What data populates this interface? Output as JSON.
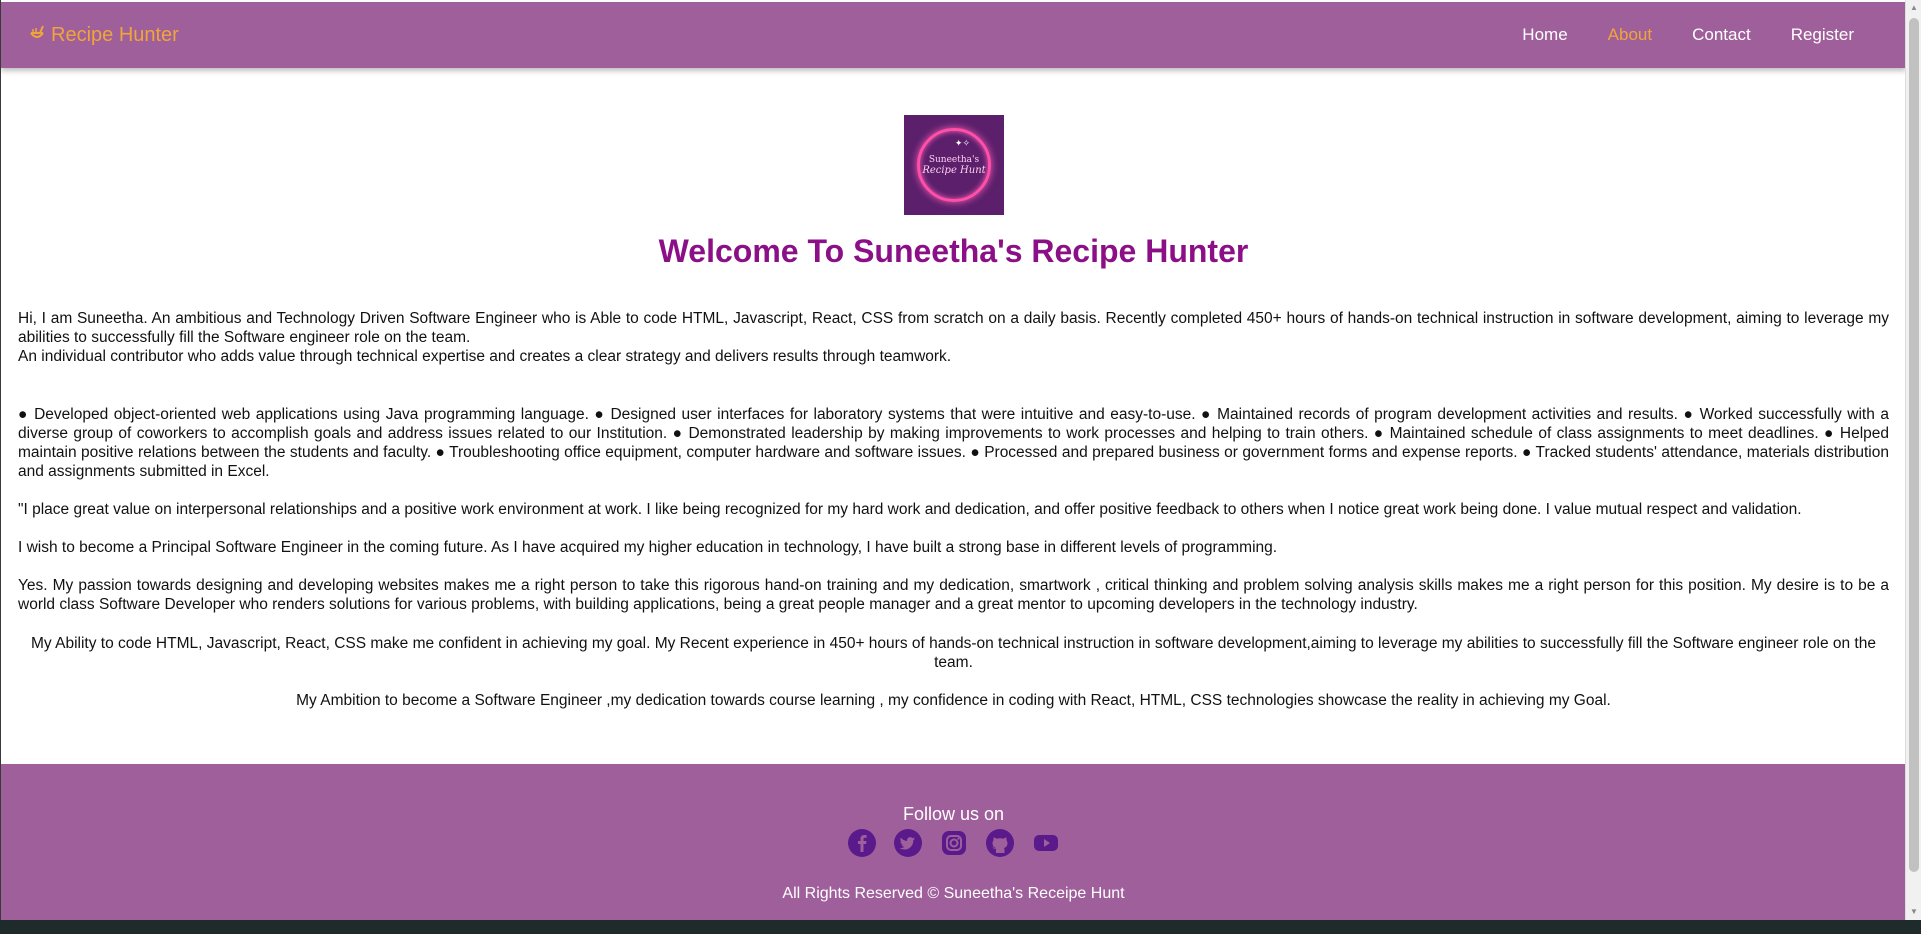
{
  "nav": {
    "brand": "Recipe Hunter",
    "links": [
      "Home",
      "About",
      "Contact",
      "Register"
    ],
    "active": "About"
  },
  "logo": {
    "line1": "Suneetha's",
    "line2": "Recipe Hunt"
  },
  "main": {
    "title": "Welcome To Suneetha's Recipe Hunter",
    "p1a": "Hi, I am Suneetha. An ambitious and Technology Driven Software Engineer who is Able to code HTML, Javascript, React, CSS from scratch on a daily basis. Recently completed 450+ hours of hands-on technical instruction in software development, aiming to leverage my abilities to successfully fill the Software engineer role on the team.",
    "p1b": "An individual contributor who adds value through technical expertise and creates a clear strategy and delivers results through teamwork.",
    "p2": "● Developed object-oriented web applications using Java programming language. ● Designed user interfaces for laboratory systems that were intuitive and easy-to-use. ● Maintained records of program development activities and results. ● Worked successfully with a diverse group of coworkers to accomplish goals and address issues related to our Institution. ● Demonstrated leadership by making improvements to work processes and helping to train others. ● Maintained schedule of class assignments to meet deadlines. ● Helped maintain positive relations between the students and faculty. ● Troubleshooting office equipment, computer hardware and software issues. ● Processed and prepared business or government forms and expense reports. ● Tracked students' attendance, materials distribution and assignments submitted in Excel.",
    "p3": "\"I place great value on interpersonal relationships and a positive work environment at work. I like being recognized for my hard work and dedication, and offer positive feedback to others when I notice great work being done. I value mutual respect and validation.",
    "p4": "I wish to become a Principal Software Engineer in the coming future. As I have acquired my higher education in technology, I have built a strong base in different levels of programming.",
    "p5": "Yes. My passion towards designing and developing websites makes me a right person to take this rigorous hand-on training and my dedication, smartwork , critical thinking and problem solving analysis skills makes me a right person for this position. My desire is to be a world class Software Developer who renders solutions for various problems, with building applications, being a great people manager and a great mentor to upcoming developers in the technology industry.",
    "p6": "My Ability to code HTML, Javascript, React, CSS make me confident in achieving my goal. My Recent experience in 450+ hours of hands-on technical instruction in software development,aiming to leverage my abilities to successfully fill the Software engineer role on the team.",
    "p7": "My Ambition to become a Software Engineer ,my dedication towards course learning , my confidence in coding with React, HTML, CSS technologies showcase the reality in achieving my Goal."
  },
  "footer": {
    "follow": "Follow us on",
    "rights": "All Rights Reserved © Suneetha's Receipe Hunt",
    "socials": [
      "facebook-icon",
      "twitter-icon",
      "instagram-icon",
      "github-icon",
      "youtube-icon"
    ]
  },
  "colors": {
    "nav_bg": "#9f5f9b",
    "brand": "#f0a53a",
    "title": "#8b0f86",
    "social_icon": "#5a1a8c"
  }
}
